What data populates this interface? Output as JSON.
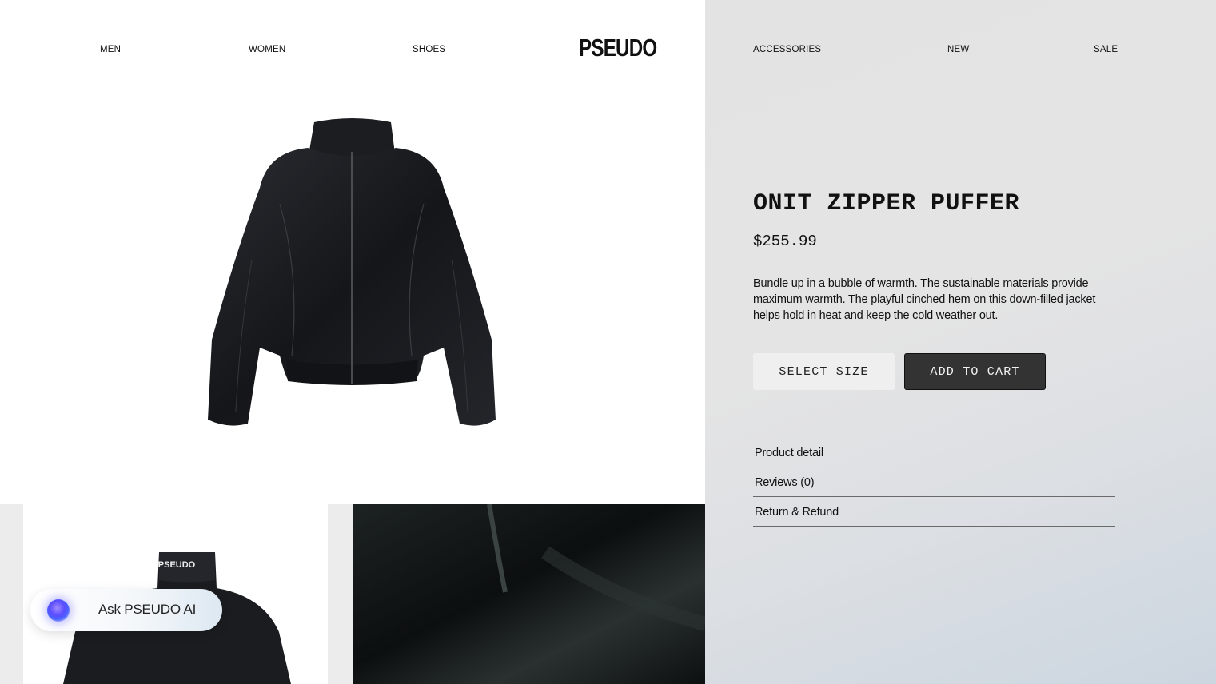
{
  "nav": {
    "left": [
      "MEN",
      "WOMEN",
      "SHOES"
    ],
    "logo": "PSEUDO",
    "right": [
      "ACCESSORIES",
      "NEW",
      "SALE"
    ]
  },
  "product": {
    "title": "ONIT ZIPPER PUFFER",
    "price": "$255.99",
    "description": "Bundle up in a bubble of warmth. The sustainable materials provide maximum warmth. The playful cinched hem on this down-filled jacket helps hold in heat and keep the cold weather out.",
    "select_size_label": "SELECT SIZE",
    "add_to_cart_label": "ADD TO CART",
    "accordion": [
      "Product detail",
      "Reviews (0)",
      "Return & Refund"
    ],
    "jacket_back_logo": "PSEUDO"
  },
  "assistant": {
    "label": "Ask PSEUDO AI"
  },
  "colors": {
    "cart_button": "#333333",
    "panel_background": "#e3e3e3",
    "jacket": "#1a1b1f"
  }
}
